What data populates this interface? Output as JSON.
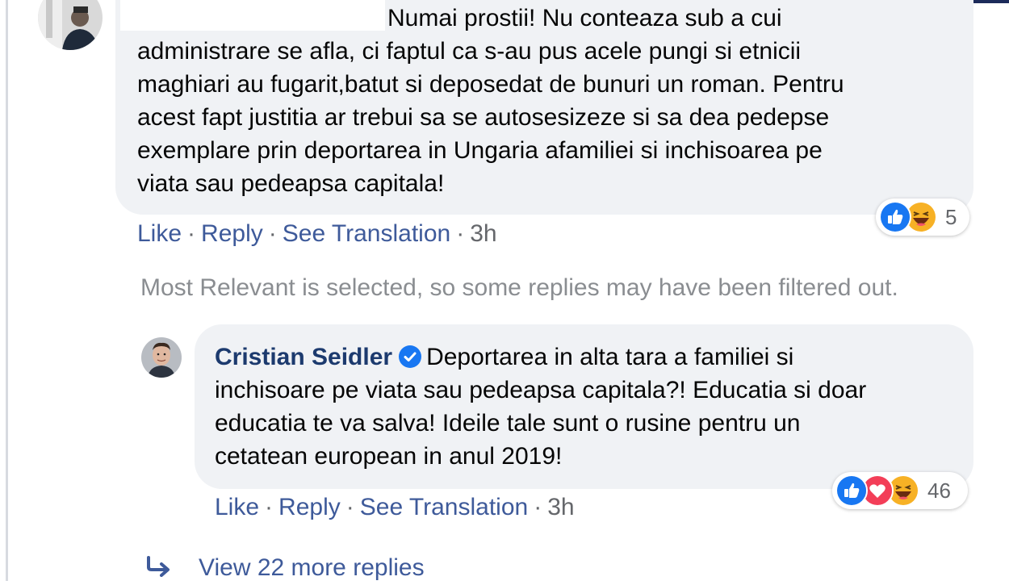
{
  "comment_1": {
    "lines": [
      "Numai prostii! Nu conteaza sub a cui",
      "administrare se afla, ci faptul ca s-au pus acele pungi si etnicii",
      "maghiari au fugarit,batut si deposedat de bunuri un roman. Pentru",
      "acest fapt justitia ar trebui sa se autosesizeze si sa dea pedepse",
      "exemplare prin deportarea in Ungaria afamiliei si inchisoarea pe",
      "viata sau pedeapsa capitala!"
    ],
    "actions": {
      "like": "Like",
      "reply": "Reply",
      "see_translation": "See Translation",
      "time": "3h",
      "separator": "·"
    },
    "reactions": {
      "types": [
        "like-icon",
        "haha-icon"
      ],
      "count": "5"
    }
  },
  "filter_note": "Most Relevant is selected, so some replies may have been filtered out.",
  "reply_1": {
    "author": "Cristian Seidler",
    "verified": true,
    "lines": [
      "Deportarea in alta tara a familiei si",
      "inchisoare pe viata sau pedeapsa capitala?! Educatia si doar",
      "educatia te va salva! Ideile tale sunt o rusine pentru un",
      "cetatean european in anul 2019!"
    ],
    "actions": {
      "like": "Like",
      "reply": "Reply",
      "see_translation": "See Translation",
      "time": "3h",
      "separator": "·"
    },
    "reactions": {
      "types": [
        "like-icon",
        "love-icon",
        "haha-icon"
      ],
      "count": "46"
    }
  },
  "view_more": "View 22 more replies",
  "colors": {
    "bubble": "#f0f2f5",
    "link": "#3e5a9a",
    "author": "#1c3a6e",
    "muted": "#8a8d91",
    "like_blue": "#1877f2",
    "love_red": "#f33e58",
    "haha_yellow": "#f7b125"
  }
}
